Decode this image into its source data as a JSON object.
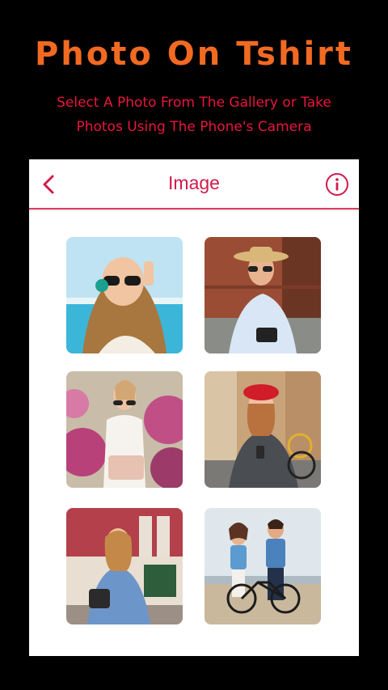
{
  "banner": {
    "headline": "Photo On Tshirt",
    "subtitle_line1": "Select A Photo From The Gallery or Take",
    "subtitle_line2": "Photos Using The Phone's Camera"
  },
  "screen": {
    "title": "Image",
    "back_icon": "chevron-left-icon",
    "info_icon": "info-circle-icon"
  },
  "gallery": {
    "items": [
      {
        "subject": "woman with sunglasses and headphones by a pool"
      },
      {
        "subject": "woman in straw hat with camera"
      },
      {
        "subject": "woman with handbag among pink flowers"
      },
      {
        "subject": "woman in red beret with bicycle"
      },
      {
        "subject": "woman in denim shirt in front of building"
      },
      {
        "subject": "couple with bicycle on beach"
      }
    ]
  },
  "colors": {
    "headline": "#f26a21",
    "subtitle": "#e8173b",
    "accent": "#d11a4a",
    "background": "#000000",
    "card": "#ffffff"
  }
}
